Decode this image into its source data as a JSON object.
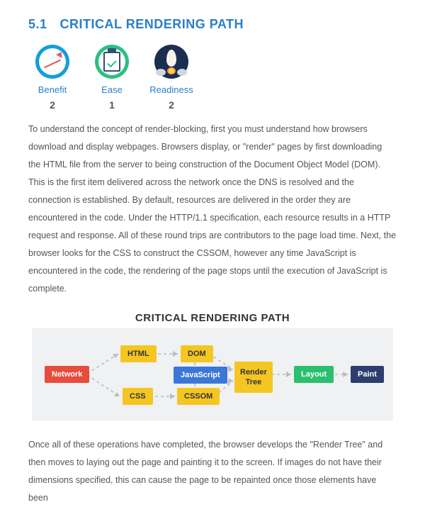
{
  "section": {
    "number": "5.1",
    "title": "CRITICAL RENDERING PATH"
  },
  "metrics": {
    "benefit": {
      "label": "Benefit",
      "value": "2"
    },
    "ease": {
      "label": "Ease",
      "value": "1"
    },
    "readiness": {
      "label": "Readiness",
      "value": "2"
    }
  },
  "paragraph1": "To understand the concept of render-blocking, first you must understand how browsers download and display webpages. Browsers display, or \"render\" pages by first downloading the HTML file from the server to being construction of the Document Object Model (DOM). This is the first item delivered across the network once the DNS is resolved and the connection is established. By default, resources are delivered in the order they are encountered in the code. Under the HTTP/1.1 specification, each resource results in a HTTP request and response. All of these round trips are contributors to the page load time. Next, the browser looks for the CSS to construct the CSSOM, however any time JavaScript is encountered in the code, the rendering of the page stops until the execution of JavaScript is complete.",
  "diagram": {
    "title": "CRITICAL RENDERING PATH",
    "nodes": {
      "network": "Network",
      "html": "HTML",
      "css": "CSS",
      "dom": "DOM",
      "js": "JavaScript",
      "cssom": "CSSOM",
      "rendertree_l1": "Render",
      "rendertree_l2": "Tree",
      "layout": "Layout",
      "paint": "Paint"
    }
  },
  "paragraph2": "Once all of these operations have completed, the browser develops the \"Render Tree\" and then moves to laying out the page and painting it to the screen. If images do not have their dimensions specified, this can cause the page to be repainted once those elements have been"
}
